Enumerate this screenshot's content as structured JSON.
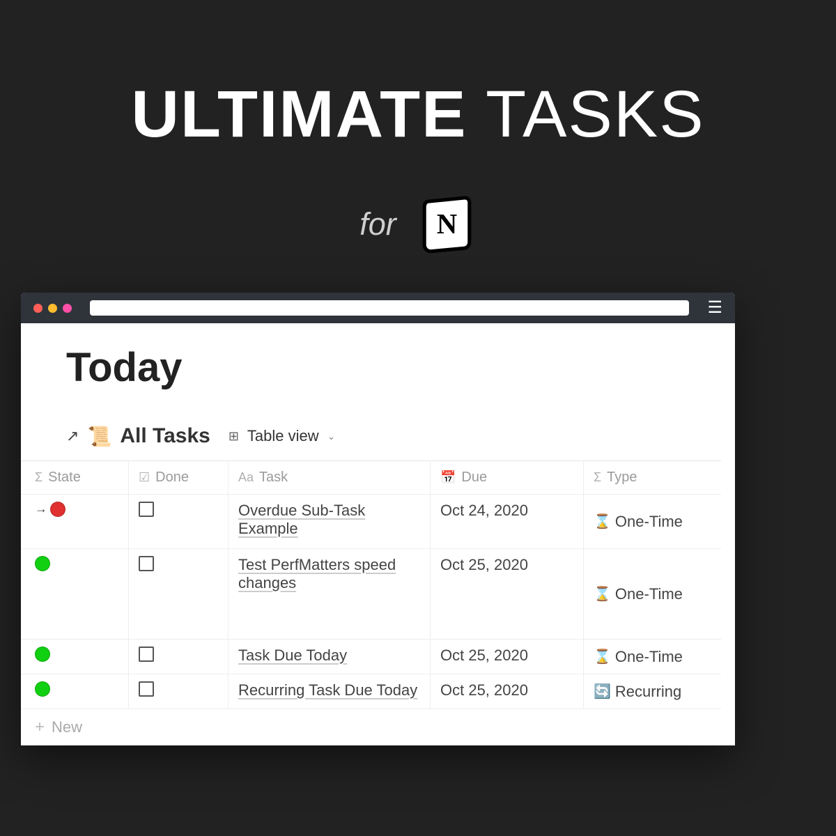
{
  "hero": {
    "bold": "ULTIMATE",
    "light": "TASKS",
    "for": "for"
  },
  "page": {
    "title": "Today"
  },
  "view": {
    "all_tasks": "All Tasks",
    "mode": "Table view"
  },
  "columns": {
    "state": "State",
    "done": "Done",
    "task": "Task",
    "due": "Due",
    "type": "Type"
  },
  "rows": [
    {
      "state_color": "red",
      "has_arrow": true,
      "task": "Overdue Sub-Task Example",
      "due": "Oct 24, 2020",
      "type_icon": "⌛",
      "type": "One-Time"
    },
    {
      "state_color": "green",
      "has_arrow": false,
      "task": "Test PerfMatters speed changes",
      "due": "Oct 25, 2020",
      "type_icon": "⌛",
      "type": "One-Time"
    },
    {
      "state_color": "green",
      "has_arrow": false,
      "task": "Task Due Today",
      "due": "Oct 25, 2020",
      "type_icon": "⌛",
      "type": "One-Time"
    },
    {
      "state_color": "green",
      "has_arrow": false,
      "task": "Recurring Task Due Today",
      "due": "Oct 25, 2020",
      "type_icon": "🔄",
      "type": "Recurring"
    }
  ],
  "new_row": "New"
}
